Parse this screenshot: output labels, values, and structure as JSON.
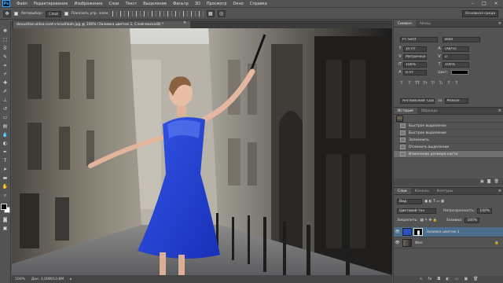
{
  "app": {
    "logo": "Ps"
  },
  "menu": [
    "Файл",
    "Редактирование",
    "Изображение",
    "Слои",
    "Текст",
    "Выделение",
    "Фильтр",
    "3D",
    "Просмотр",
    "Окно",
    "Справка"
  ],
  "window_controls": [
    "–",
    "□",
    "×"
  ],
  "options_bar": {
    "auto_select_label": "Автовыбор:",
    "auto_select_value": "Слой",
    "show_transform_label": "Показать упр. элем.",
    "workspace": "Основная среда"
  },
  "document": {
    "tab_title": "devushka-ulitsa-svet-v-kruzhkah.jpg @ 100% (Заливка цветом 1, Слой-маска/8) *",
    "zoom": "100%",
    "doc_size": "Док: 3,00М/10,8М"
  },
  "character_panel": {
    "tabs": [
      "Символ",
      "Абзац"
    ],
    "font_family": "PT Serif",
    "font_style": "Bold",
    "font_size": "10 пт",
    "leading": "(Авто)",
    "kerning": "Метрически",
    "tracking": "0",
    "vscale": "100%",
    "hscale": "100%",
    "baseline": "0 пт",
    "color_label": "Цвет:",
    "type_buttons": [
      "T",
      "T",
      "TT",
      "Tт",
      "T¹",
      "T₁",
      "T",
      "T"
    ],
    "language": "Английский: США",
    "aa_icon": "aa",
    "aa_mode": "Резкое"
  },
  "history_panel": {
    "tabs": [
      "История",
      "Образцы"
    ],
    "items": [
      "Быстрое выделение",
      "Быстрое выделение",
      "Запомнить",
      "Отменить выделение",
      "Изменение размера кисти"
    ],
    "active_index": 4
  },
  "layers_panel": {
    "tabs": [
      "Слои",
      "Каналы",
      "Контуры"
    ],
    "filter_kind": "Вид",
    "blend_mode": "Цветовой тон",
    "opacity_label": "Непрозрачность:",
    "opacity_value": "100%",
    "lock_label": "Закрепить:",
    "fill_label": "Заливка:",
    "fill_value": "100%",
    "layers": [
      {
        "name": "Заливка цветом 1",
        "fill_color": "#2b4fc8",
        "selected": true,
        "has_mask": true
      },
      {
        "name": "Фон",
        "selected": false,
        "has_mask": false
      }
    ],
    "footer_icons": [
      "link-icon",
      "fx-icon",
      "mask-icon",
      "adjustment-icon",
      "folder-icon",
      "new-layer-icon",
      "trash-icon"
    ]
  },
  "colors": {
    "dress_blue": "#1e3fd0",
    "ui_gray": "#535353",
    "selected_layer": "#4d6d8c"
  }
}
